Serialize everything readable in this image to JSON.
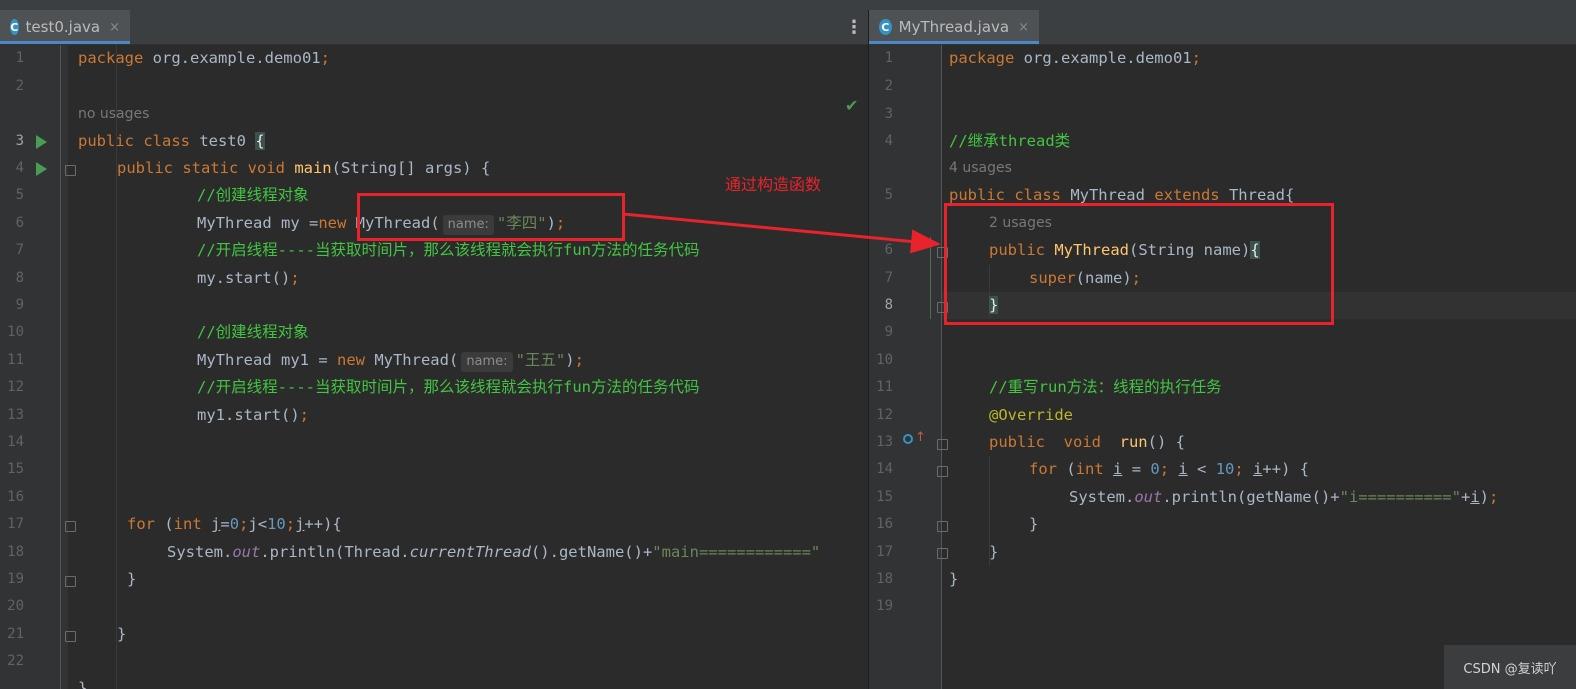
{
  "tabs": {
    "left": {
      "label": "test0.java",
      "icon": "C",
      "close": "×"
    },
    "right": {
      "label": "MyThread.java",
      "icon": "C",
      "close": "×"
    },
    "more": "⋮"
  },
  "left_editor": {
    "line_numbers": [
      "1",
      "2",
      "3",
      "4",
      "5",
      "6",
      "7",
      "8",
      "9",
      "10",
      "11",
      "12",
      "13",
      "14",
      "15",
      "16",
      "17",
      "18",
      "19",
      "20",
      "21",
      "22"
    ],
    "usage_hint": "no usages",
    "status_check": "✔",
    "code": {
      "l1_kw": "package",
      "l1_rest": " org.example.demo01",
      "l1_semi": ";",
      "l3_kw": "public class",
      "l3_rest": " test0 ",
      "l3_brace": "{",
      "l4_kw": "public static void",
      "l4_fn": " main",
      "l4_rest": "(String[] args) {",
      "l5_cmt": "//创建线程对象",
      "l6_a": "MyThread my =",
      "l6_kw": "new",
      "l6_b": " MyThread(",
      "l6_hint": "name:",
      "l6_str": "\"李四\"",
      "l6_c": ")",
      "l6_semi": ";",
      "l7_cmt": "//开启线程----当获取时间片，那么该线程就会执行fun方法的任务代码",
      "l8_a": "my.start()",
      "l8_semi": ";",
      "l10_cmt": "//创建线程对象",
      "l11_a": "MyThread my1 = ",
      "l11_kw": "new",
      "l11_b": " MyThread(",
      "l11_hint": "name:",
      "l11_str": "\"王五\"",
      "l11_c": ")",
      "l11_semi": ";",
      "l12_cmt": "//开启线程----当获取时间片，那么该线程就会执行fun方法的任务代码",
      "l13_a": "my1.start()",
      "l13_semi": ";",
      "l17_kw": "for",
      "l17_a": " (",
      "l17_kw2": "int",
      "l17_b": " ",
      "l17_j1": "j",
      "l17_c": "=",
      "l17_n0": "0",
      "l17_s1": ";",
      "l17_d": "j<",
      "l17_n10": "10",
      "l17_s2": ";",
      "l17_j3": "j",
      "l17_e": "++){",
      "l18_a": "System.",
      "l18_out": "out",
      "l18_b": ".println(Thread.",
      "l18_ct": "currentThread",
      "l18_c": "().getName()+",
      "l18_str": "\"main============\"",
      "l19": "}",
      "l21": "}",
      "l22": "}"
    }
  },
  "right_editor": {
    "line_numbers": [
      "1",
      "2",
      "3",
      "4",
      "",
      "5",
      "",
      "6",
      "7",
      "8",
      "9",
      "10",
      "11",
      "12",
      "13",
      "14",
      "15",
      "16",
      "17",
      "18",
      "19"
    ],
    "usage_4": "4 usages",
    "usage_2": "2 usages",
    "code": {
      "l1_kw": "package",
      "l1_rest": " org.example.demo01",
      "l1_semi": ";",
      "l4_cmt": "//继承thread类",
      "l5_kw": "public class",
      "l5_a": " MyThread ",
      "l5_kw2": "extends",
      "l5_b": " Thread{",
      "l6_kw": "public",
      "l6_fn": " MyThread",
      "l6_a": "(String name)",
      "l6_brace": "{",
      "l7_kw": "super",
      "l7_a": "(name)",
      "l7_semi": ";",
      "l8_brace": "}",
      "l11_cmt": "//重写run方法：线程的执行任务",
      "l12_ann": "@Override",
      "l13_kw": "public  void",
      "l13_fn": "  run",
      "l13_a": "() {",
      "l14_kw": "for",
      "l14_a": " (",
      "l14_kw2": "int",
      "l14_b": " ",
      "l14_i1": "i",
      "l14_c": " = ",
      "l14_n0": "0",
      "l14_s1": "; ",
      "l14_i2": "i",
      "l14_d": " < ",
      "l14_n10": "10",
      "l14_s2": "; ",
      "l14_i3": "i",
      "l14_e": "++) {",
      "l15_a": "System.",
      "l15_out": "out",
      "l15_b": ".println(getName()+",
      "l15_str": "\"i==========\"",
      "l15_c": "+",
      "l15_i": "i",
      "l15_d": ")",
      "l15_semi": ";",
      "l16": "}",
      "l17": "}",
      "l18": "}"
    }
  },
  "annotation": {
    "label": "通过构造函数",
    "color": "#e8232b"
  },
  "watermark": "CSDN @复读吖",
  "colors": {
    "keyword": "#cc7832",
    "string": "#6a8759",
    "number": "#6897bb",
    "comment": "#42c542",
    "method": "#ffc66d",
    "annotation": "#bbb529"
  }
}
